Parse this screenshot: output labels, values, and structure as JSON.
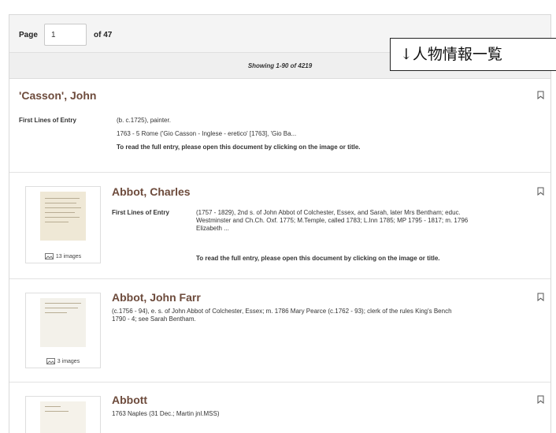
{
  "pager": {
    "page_label": "Page",
    "page_value": "1",
    "of_label": "of 47"
  },
  "showing": "Showing 1-90 of 4219",
  "overlay_note": "↓人物情報一覧",
  "entries": [
    {
      "name": "'Casson', John",
      "first_lines_label": "First Lines of Entry",
      "line1": "(b. c.1725), painter.",
      "line2": "1763 - 5 Rome ('Gio Casson - Inglese - eretico' [1763], 'Gio Ba...",
      "note": "To read the full entry, please open this document by clicking on the image or title."
    },
    {
      "name": "Abbot, Charles",
      "first_lines_label": "First Lines of Entry",
      "line1": "(1757 - 1829), 2nd s. of John Abbot of Colchester, Essex, and Sarah, later Mrs Bentham; educ.",
      "line2": "Westminster and Ch.Ch. Oxf. 1775; M.Temple, called 1783; L.Inn 1785; MP 1795 - 1817; m. 1796",
      "line3": "Elizabeth ...",
      "note": "To read the full entry, please open this document by clicking on the image or title.",
      "images": "13 images"
    },
    {
      "name": "Abbot, John Farr",
      "line1": "(c.1756 - 94), e. s. of John Abbot of Colchester, Essex; m. 1786 Mary Pearce (c.1762 - 93); clerk of the rules King's Bench",
      "line2": "1790 - 4; see Sarah Bentham.",
      "images": "3 images"
    },
    {
      "name": "Abbott",
      "line1": "1763 Naples (31 Dec.; Martin jnl.MSS)"
    }
  ]
}
